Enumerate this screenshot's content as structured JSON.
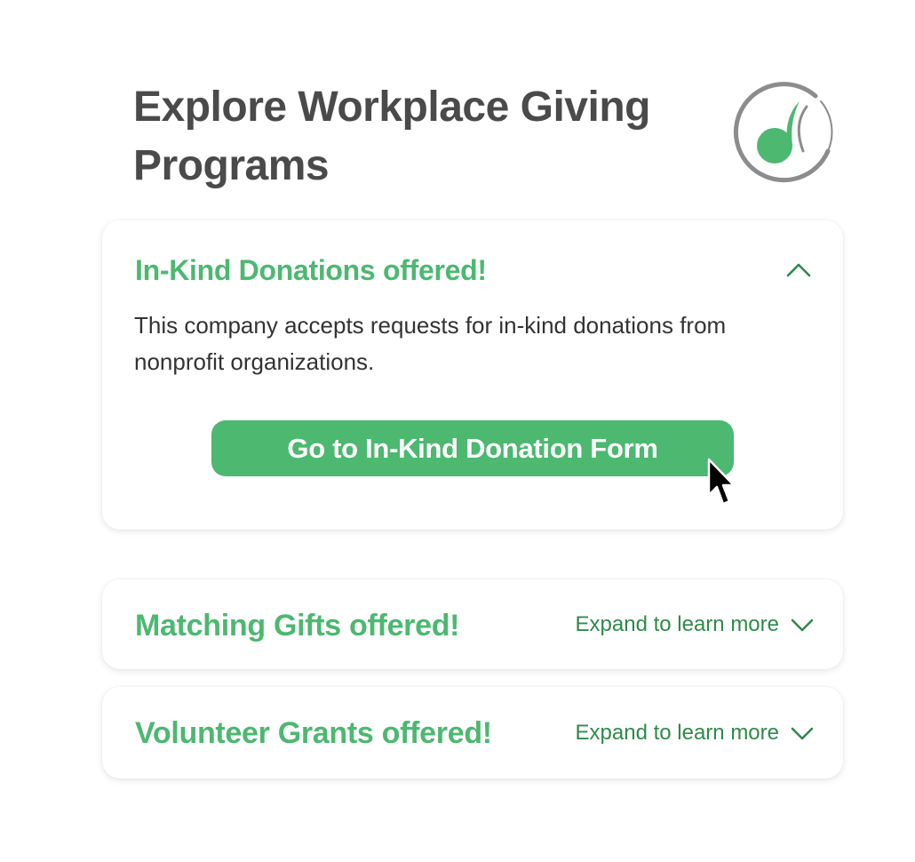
{
  "page": {
    "title": "Explore Workplace Giving Programs"
  },
  "colors": {
    "accent_green": "#4cb870",
    "dark_green": "#2f8a4a",
    "title_gray": "#4a4a4a",
    "logo_gray": "#8c8c8c"
  },
  "logo": {
    "icon": "double-the-donation-logo-icon"
  },
  "cards": {
    "in_kind": {
      "heading": "In-Kind Donations offered!",
      "expanded": true,
      "toggle_icon": "chevron-up-icon",
      "description": "This company accepts requests for in-kind donations from nonprofit organizations.",
      "button_label": "Go to In-Kind Donation Form"
    },
    "matching": {
      "heading": "Matching Gifts offered!",
      "expanded": false,
      "expand_label": "Expand to learn more",
      "toggle_icon": "chevron-down-icon"
    },
    "volunteer": {
      "heading": "Volunteer Grants offered!",
      "expanded": false,
      "expand_label": "Expand to learn more",
      "toggle_icon": "chevron-down-icon"
    }
  },
  "cursor": {
    "icon": "mouse-pointer-icon"
  }
}
